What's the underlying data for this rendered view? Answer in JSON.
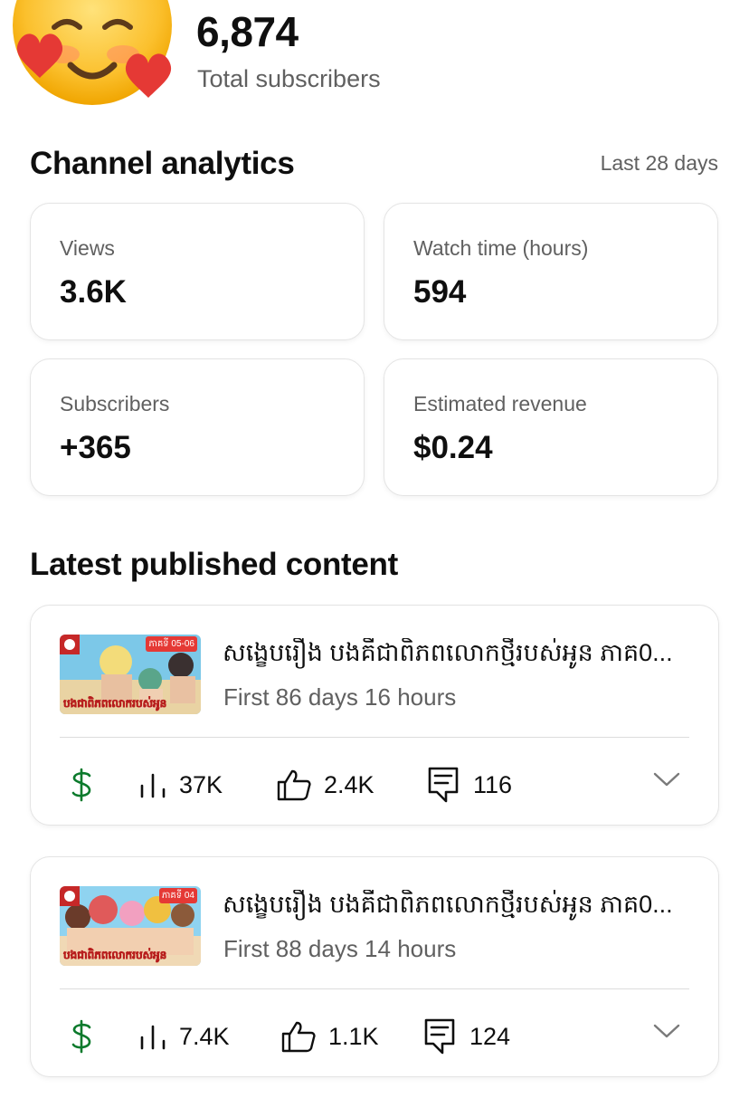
{
  "header": {
    "subscriber_count": "6,874",
    "subscriber_label": "Total subscribers"
  },
  "analytics": {
    "title": "Channel analytics",
    "period": "Last 28 days",
    "cards": [
      {
        "label": "Views",
        "value": "3.6K"
      },
      {
        "label": "Watch time (hours)",
        "value": "594"
      },
      {
        "label": "Subscribers",
        "value": "+365"
      },
      {
        "label": "Estimated revenue",
        "value": "$0.24"
      }
    ]
  },
  "latest": {
    "title": "Latest published content",
    "videos": [
      {
        "title": "សង្ខេបរឿង បងគឺជាពិភពលោកថ្មីរបស់អូន ភាគ0...",
        "age": "First 86 days 16 hours",
        "views": "37K",
        "likes": "2.4K",
        "comments": "116",
        "thumb_label": "បងជាពិភពលោករបស់អូន",
        "thumb_badge": "ភាគទី 05-06"
      },
      {
        "title": "សង្ខេបរឿង បងគឺជាពិភពលោកថ្មីរបស់អូន ភាគ0...",
        "age": "First 88 days 14 hours",
        "views": "7.4K",
        "likes": "1.1K",
        "comments": "124",
        "thumb_label": "បងជាពិភពលោករបស់អូន",
        "thumb_badge": "ភាគទី 04"
      }
    ]
  },
  "colors": {
    "revenue_icon": "#0b7a2c",
    "text_secondary": "#606060"
  },
  "icons": {
    "avatar": "smiling-face-with-hearts-emoji",
    "revenue": "dollar-icon",
    "views": "bar-chart-icon",
    "likes": "thumbs-up-icon",
    "comments": "comment-icon",
    "expand": "chevron-down-icon"
  }
}
